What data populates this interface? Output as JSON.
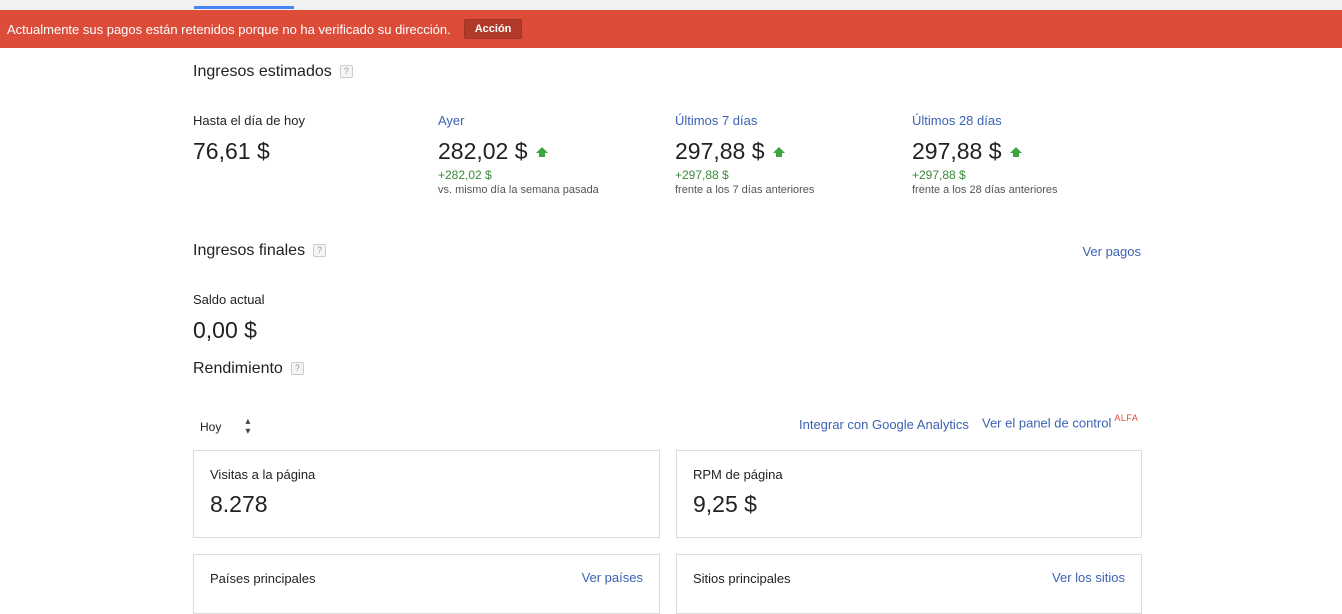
{
  "alert": {
    "message": "Actualmente sus pagos están retenidos porque no ha verificado su dirección.",
    "action_label": "Acción"
  },
  "estimated": {
    "title": "Ingresos estimados",
    "help": "?",
    "today": {
      "label": "Hasta el día de hoy",
      "value": "76,61 $"
    },
    "yesterday": {
      "label": "Ayer",
      "value": "282,02 $",
      "delta": "+282,02 $",
      "note": "vs. mismo día la semana pasada"
    },
    "last7": {
      "label": "Últimos 7 días",
      "value": "297,88 $",
      "delta": "+297,88 $",
      "note": "frente a los 7 días anteriores"
    },
    "last28": {
      "label": "Últimos 28 días",
      "value": "297,88 $",
      "delta": "+297,88 $",
      "note": "frente a los 28 días anteriores"
    }
  },
  "final": {
    "title": "Ingresos finales",
    "help": "?",
    "payments_link": "Ver pagos",
    "balance_label": "Saldo actual",
    "balance_value": "0,00 $"
  },
  "performance": {
    "title": "Rendimiento",
    "help": "?",
    "period": "Hoy",
    "period_arrows": "▲▼",
    "analytics_link": "Integrar con Google Analytics",
    "dashboard_link": "Ver el panel de control",
    "alfa": "ALFA",
    "cards": {
      "pageviews": {
        "title": "Visitas a la página",
        "value": "8.278"
      },
      "rpm": {
        "title": "RPM de página",
        "value": "9,25 $"
      },
      "countries": {
        "title": "Países principales",
        "link": "Ver países"
      },
      "sites": {
        "title": "Sitios principales",
        "link": "Ver los sitios"
      }
    }
  },
  "colors": {
    "alert_bg": "#dd4b39",
    "link": "#3b62b3",
    "positive": "#3ea53e",
    "tab_accent": "#4285f4"
  },
  "icons": {
    "trend": "up-arrow-icon",
    "help": "help-icon",
    "sort": "sort-arrows-icon"
  }
}
